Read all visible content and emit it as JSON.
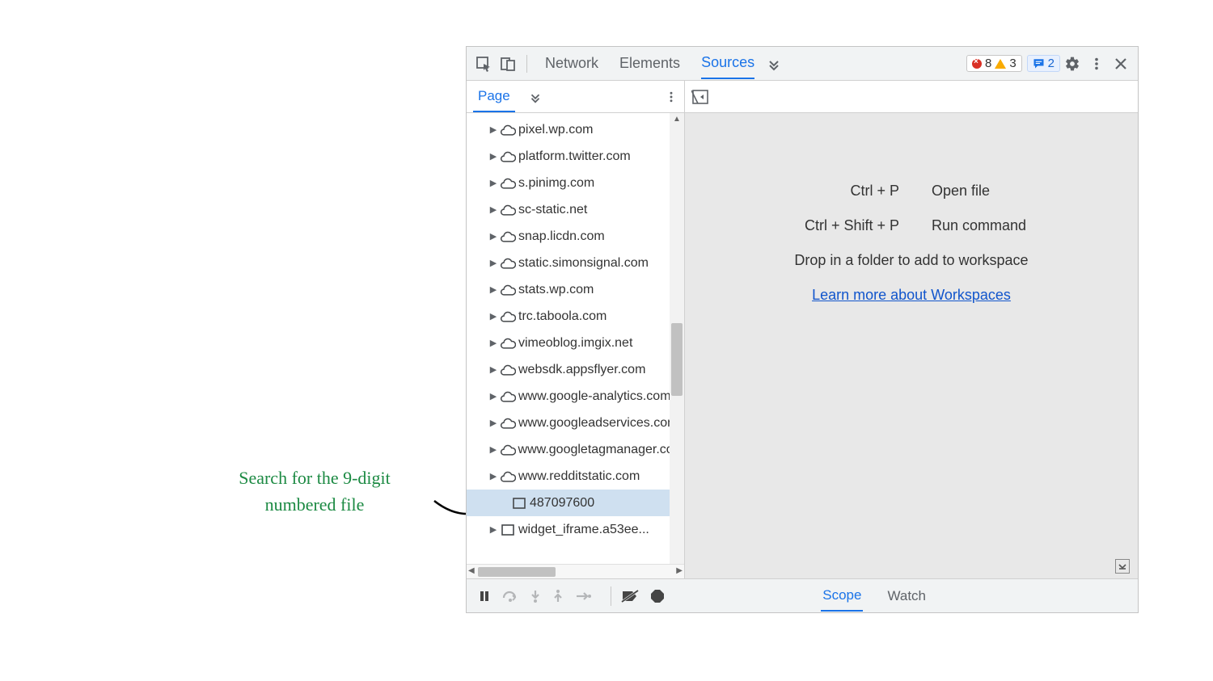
{
  "annotation": {
    "line1": "Search for the 9-digit",
    "line2": "numbered file"
  },
  "toolbar": {
    "tabs": {
      "network": "Network",
      "elements": "Elements",
      "sources": "Sources"
    },
    "errors": "8",
    "warnings": "3",
    "messages": "2"
  },
  "subbar": {
    "page_tab": "Page"
  },
  "tree": [
    {
      "type": "cloud",
      "label": "pixel.wp.com"
    },
    {
      "type": "cloud",
      "label": "platform.twitter.com"
    },
    {
      "type": "cloud",
      "label": "s.pinimg.com"
    },
    {
      "type": "cloud",
      "label": "sc-static.net"
    },
    {
      "type": "cloud",
      "label": "snap.licdn.com"
    },
    {
      "type": "cloud",
      "label": "static.simonsignal.com"
    },
    {
      "type": "cloud",
      "label": "stats.wp.com"
    },
    {
      "type": "cloud",
      "label": "trc.taboola.com"
    },
    {
      "type": "cloud",
      "label": "vimeoblog.imgix.net"
    },
    {
      "type": "cloud",
      "label": "websdk.appsflyer.com"
    },
    {
      "type": "cloud",
      "label": "www.google-analytics.com"
    },
    {
      "type": "cloud",
      "label": "www.googleadservices.com"
    },
    {
      "type": "cloud",
      "label": "www.googletagmanager.com"
    },
    {
      "type": "cloud",
      "label": "www.redditstatic.com"
    },
    {
      "type": "file",
      "label": "487097600",
      "selected": true
    },
    {
      "type": "folder",
      "label": "widget_iframe.a53ee..."
    }
  ],
  "editor": {
    "shortcut1_key": "Ctrl + P",
    "shortcut1_desc": "Open file",
    "shortcut2_key": "Ctrl + Shift + P",
    "shortcut2_desc": "Run command",
    "drop_note": "Drop in a folder to add to workspace",
    "link": "Learn more about Workspaces"
  },
  "bottom": {
    "scope": "Scope",
    "watch": "Watch"
  }
}
